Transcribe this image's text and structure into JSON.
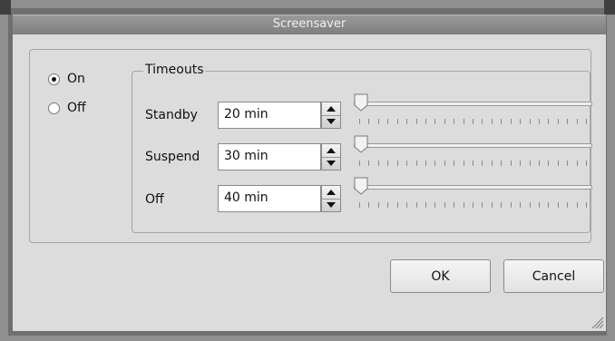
{
  "window": {
    "title": "Screensaver"
  },
  "mode": {
    "selected": "On",
    "options": [
      {
        "label": "On",
        "checked": true
      },
      {
        "label": "Off",
        "checked": false
      }
    ]
  },
  "timeouts": {
    "legend": "Timeouts",
    "rows": [
      {
        "label": "Standby",
        "value": "20 min",
        "level": 0.0
      },
      {
        "label": "Suspend",
        "value": "30 min",
        "level": 0.0
      },
      {
        "label": "Off",
        "value": "40 min",
        "level": 0.0
      }
    ]
  },
  "buttons": {
    "ok": "OK",
    "cancel": "Cancel"
  },
  "icons": {
    "spin_up": "triangle-up-icon",
    "spin_down": "triangle-down-icon",
    "resize": "resize-grip-icon"
  }
}
